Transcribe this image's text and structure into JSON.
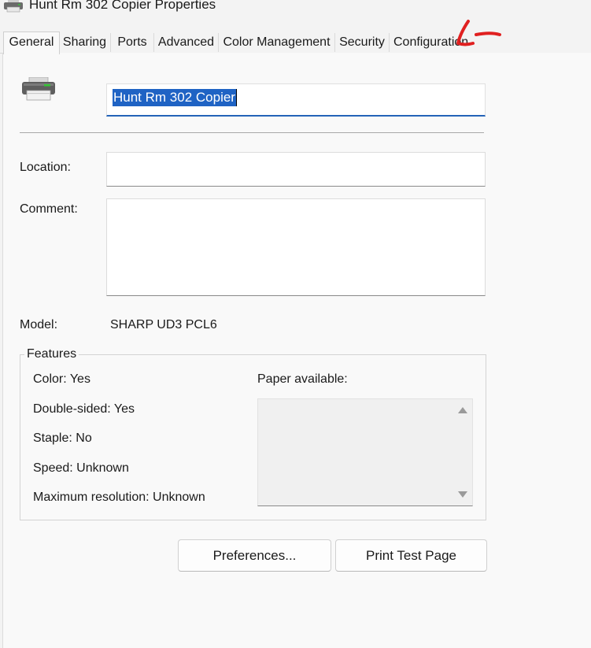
{
  "window": {
    "title": "Hunt Rm 302 Copier Properties"
  },
  "tabs": [
    {
      "label": "General",
      "active": true
    },
    {
      "label": "Sharing"
    },
    {
      "label": "Ports"
    },
    {
      "label": "Advanced"
    },
    {
      "label": "Color Management"
    },
    {
      "label": "Security"
    },
    {
      "label": "Configuration"
    }
  ],
  "general": {
    "printer_name": "Hunt Rm 302 Copier",
    "location_label": "Location:",
    "location_value": "",
    "comment_label": "Comment:",
    "comment_value": "",
    "model_label": "Model:",
    "model_value": "SHARP UD3 PCL6"
  },
  "features": {
    "title": "Features",
    "color": "Color: Yes",
    "double_sided": "Double-sided: Yes",
    "staple": "Staple: No",
    "speed": "Speed: Unknown",
    "max_resolution": "Maximum resolution: Unknown",
    "paper_available_label": "Paper available:",
    "paper_available_items": []
  },
  "buttons": {
    "preferences": "Preferences...",
    "print_test_page": "Print Test Page"
  },
  "icons": {
    "title": "printer-icon",
    "main": "printer-icon",
    "scroll_up": "scroll-up-arrow-icon",
    "scroll_down": "scroll-down-arrow-icon"
  },
  "colors": {
    "selection": "#1f63c4",
    "focus_underline": "#2463b8",
    "annotation": "#e02020"
  }
}
